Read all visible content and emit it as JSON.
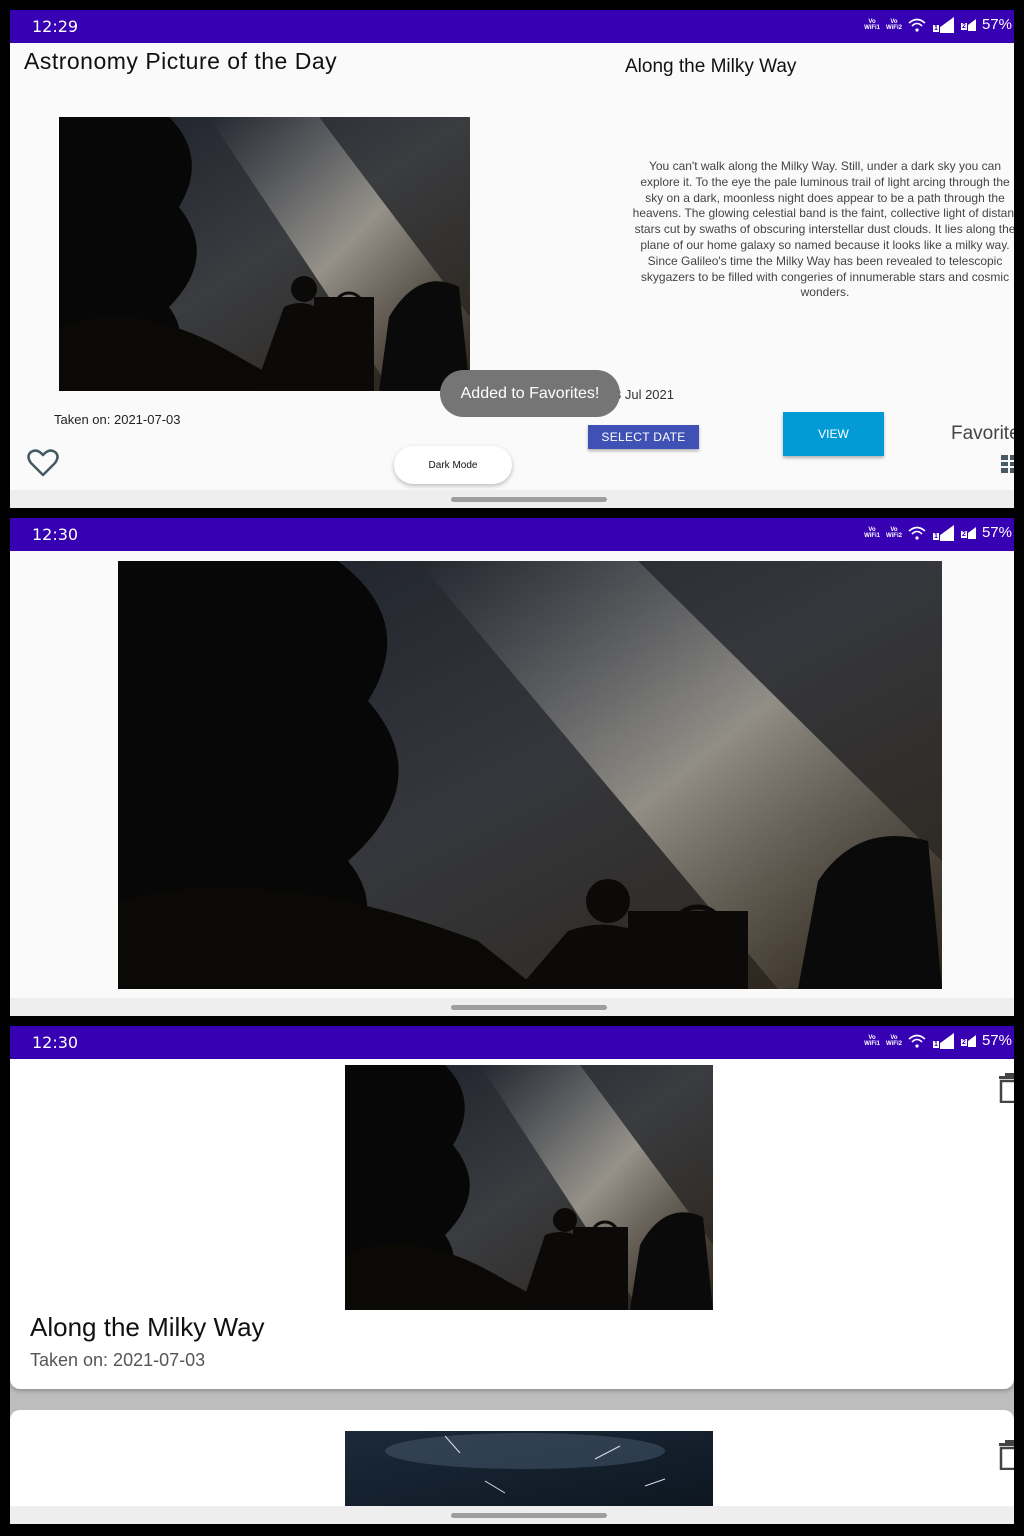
{
  "screens": [
    {
      "status": {
        "time": "12:29",
        "wifi1": "Vo WiFi1",
        "wifi2": "Vo WiFi2",
        "sim1": "1",
        "sim2": "2",
        "battery": "57%"
      },
      "app_title": "Astronomy Picture of the Day",
      "picture_title": "Along the Milky Way",
      "explanation": "You can't walk along the Milky Way. Still, under a dark sky you can explore it. To the eye the pale luminous trail of light arcing through the sky on a dark, moonless night does appear to be a path through the heavens. The glowing celestial band is the faint, collective light of distant stars cut by swaths of obscuring interstellar dust clouds. It lies along the plane of our home galaxy so named because it looks like a milky way. Since Galileo's time the Milky Way has been revealed to telescopic skygazers to be filled with congeries of innumerable stars and cosmic wonders.",
      "taken_on": "Taken on: 2021-07-03",
      "date_label": "3 Jul 2021",
      "toast": "Added to Favorites!",
      "buttons": {
        "dark_mode": "Dark Mode",
        "select_date": "SELECT DATE",
        "view": "VIEW",
        "favorites": "Favorites"
      },
      "icons": {
        "favorite": "heart-outline-icon",
        "grid": "grid-icon"
      }
    },
    {
      "status": {
        "time": "12:30",
        "wifi1": "Vo WiFi1",
        "wifi2": "Vo WiFi2",
        "sim1": "1",
        "sim2": "2",
        "battery": "57%"
      }
    },
    {
      "status": {
        "time": "12:30",
        "wifi1": "Vo WiFi1",
        "wifi2": "Vo WiFi2",
        "sim1": "1",
        "sim2": "2",
        "battery": "57%"
      },
      "favorites": [
        {
          "title": "Along the Milky Way",
          "taken_on": "Taken on: 2021-07-03",
          "icon": "trash-icon"
        },
        {
          "icon": "trash-icon"
        }
      ]
    }
  ],
  "colors": {
    "status_bar": "#3700b3",
    "select_date": "#3f51b5",
    "view": "#039bd5",
    "toast": "#757575"
  }
}
